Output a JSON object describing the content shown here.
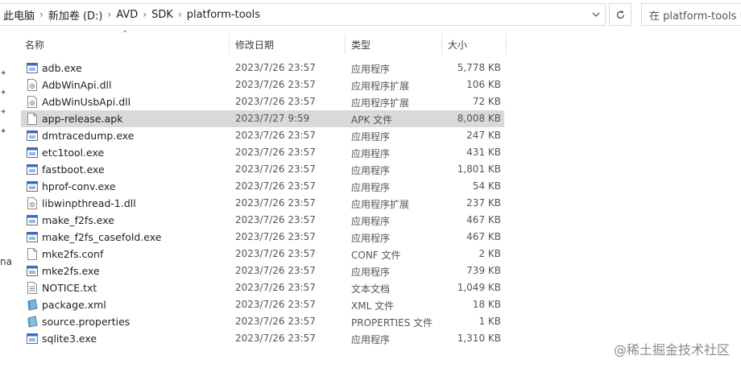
{
  "breadcrumb": {
    "items": [
      "此电脑",
      "新加卷 (D:)",
      "AVD",
      "SDK",
      "platform-tools"
    ]
  },
  "search": {
    "text": "在 platform-tools 中"
  },
  "leftpane": {
    "fragment": "na"
  },
  "columns": {
    "name": "名称",
    "date": "修改日期",
    "type": "类型",
    "size": "大小"
  },
  "files": [
    {
      "name": "adb.exe",
      "date": "2023/7/26 23:57",
      "type": "应用程序",
      "size": "5,778 KB",
      "icon": "exe-icon"
    },
    {
      "name": "AdbWinApi.dll",
      "date": "2023/7/26 23:57",
      "type": "应用程序扩展",
      "size": "106 KB",
      "icon": "dll-icon"
    },
    {
      "name": "AdbWinUsbApi.dll",
      "date": "2023/7/26 23:57",
      "type": "应用程序扩展",
      "size": "72 KB",
      "icon": "dll-icon"
    },
    {
      "name": "app-release.apk",
      "date": "2023/7/27 9:59",
      "type": "APK 文件",
      "size": "8,008 KB",
      "icon": "file-icon",
      "selected": true
    },
    {
      "name": "dmtracedump.exe",
      "date": "2023/7/26 23:57",
      "type": "应用程序",
      "size": "247 KB",
      "icon": "exe-icon"
    },
    {
      "name": "etc1tool.exe",
      "date": "2023/7/26 23:57",
      "type": "应用程序",
      "size": "431 KB",
      "icon": "exe-icon"
    },
    {
      "name": "fastboot.exe",
      "date": "2023/7/26 23:57",
      "type": "应用程序",
      "size": "1,801 KB",
      "icon": "exe-icon"
    },
    {
      "name": "hprof-conv.exe",
      "date": "2023/7/26 23:57",
      "type": "应用程序",
      "size": "54 KB",
      "icon": "exe-icon"
    },
    {
      "name": "libwinpthread-1.dll",
      "date": "2023/7/26 23:57",
      "type": "应用程序扩展",
      "size": "237 KB",
      "icon": "dll-icon"
    },
    {
      "name": "make_f2fs.exe",
      "date": "2023/7/26 23:57",
      "type": "应用程序",
      "size": "467 KB",
      "icon": "exe-icon"
    },
    {
      "name": "make_f2fs_casefold.exe",
      "date": "2023/7/26 23:57",
      "type": "应用程序",
      "size": "467 KB",
      "icon": "exe-icon"
    },
    {
      "name": "mke2fs.conf",
      "date": "2023/7/26 23:57",
      "type": "CONF 文件",
      "size": "2 KB",
      "icon": "file-icon"
    },
    {
      "name": "mke2fs.exe",
      "date": "2023/7/26 23:57",
      "type": "应用程序",
      "size": "739 KB",
      "icon": "exe-icon"
    },
    {
      "name": "NOTICE.txt",
      "date": "2023/7/26 23:57",
      "type": "文本文档",
      "size": "1,049 KB",
      "icon": "text-file-icon"
    },
    {
      "name": "package.xml",
      "date": "2023/7/26 23:57",
      "type": "XML 文件",
      "size": "18 KB",
      "icon": "xml-icon"
    },
    {
      "name": "source.properties",
      "date": "2023/7/26 23:57",
      "type": "PROPERTIES 文件",
      "size": "1 KB",
      "icon": "properties-icon"
    },
    {
      "name": "sqlite3.exe",
      "date": "2023/7/26 23:57",
      "type": "应用程序",
      "size": "1,310 KB",
      "icon": "exe-icon"
    }
  ],
  "watermark": "@稀土掘金技术社区"
}
